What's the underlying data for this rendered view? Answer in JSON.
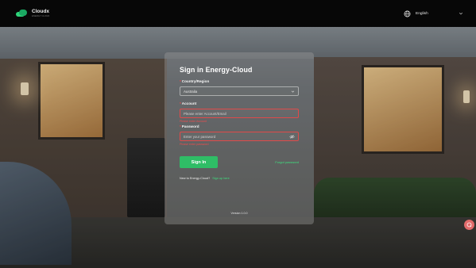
{
  "brand": {
    "name": "Cloudx",
    "tagline": "ENERGY CLOUD",
    "accent": "#2fbd66"
  },
  "header": {
    "language": "English",
    "globe_icon": "globe-icon",
    "chevron_icon": "chevron-down-icon"
  },
  "login": {
    "title": "Sign in Energy-Cloud",
    "country": {
      "label": "Country/Region",
      "value": "Australia"
    },
    "account": {
      "label": "Account",
      "placeholder": "Please enter Account/Email",
      "error": "Please enter Account"
    },
    "password": {
      "label": "Password",
      "placeholder": "Enter your password",
      "error": "Please enter password"
    },
    "signin_label": "Sign In",
    "forgot_label": "Forgot password",
    "new_user_text": "New to Energy-Cloud?",
    "signup_label": "Sign up here",
    "version": "Version 1.0.0"
  },
  "colors": {
    "error": "#ef4d4d",
    "link": "#3ee07f",
    "topbar": "#070707"
  }
}
